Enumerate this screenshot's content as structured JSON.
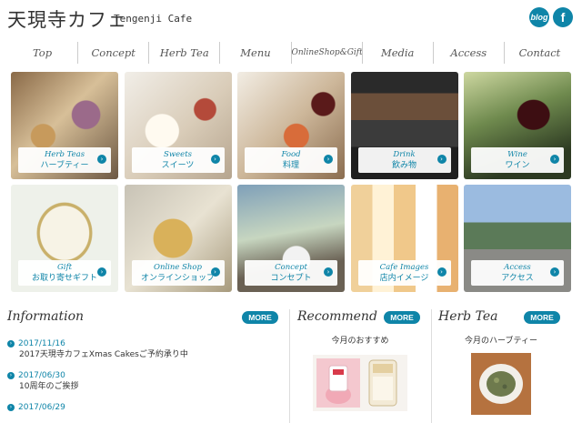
{
  "header": {
    "logo_jp": "天現寺カフェ",
    "logo_en": "Tengenji Cafe",
    "blog_label": "blog",
    "facebook_label": "f"
  },
  "nav": {
    "items": [
      {
        "label": "Top"
      },
      {
        "label": "Concept"
      },
      {
        "label": "Herb Tea"
      },
      {
        "label": "Menu"
      },
      {
        "label": "OnlineShop&Gift"
      },
      {
        "label": "Media"
      },
      {
        "label": "Access"
      },
      {
        "label": "Contact"
      }
    ]
  },
  "tiles": [
    {
      "en": "Herb Teas",
      "jp": "ハーブティー"
    },
    {
      "en": "Sweets",
      "jp": "スイーツ"
    },
    {
      "en": "Food",
      "jp": "料理"
    },
    {
      "en": "Drink",
      "jp": "飲み物"
    },
    {
      "en": "Wine",
      "jp": "ワイン"
    },
    {
      "en": "Gift",
      "jp": "お取り寄せギフト"
    },
    {
      "en": "Online Shop",
      "jp": "オンラインショップ"
    },
    {
      "en": "Concept",
      "jp": "コンセプト"
    },
    {
      "en": "Cafe Images",
      "jp": "店内イメージ"
    },
    {
      "en": "Access",
      "jp": "アクセス"
    }
  ],
  "tile_arrow": "›",
  "information": {
    "title": "Information",
    "more": "MORE",
    "items": [
      {
        "date": "2017/11/16",
        "title": "2017天現寺カフェXmas Cakesご予約承り中"
      },
      {
        "date": "2017/06/30",
        "title": "10周年のご挨拶"
      },
      {
        "date": "2017/06/29",
        "title": ""
      }
    ]
  },
  "recommend": {
    "title": "Recommend",
    "more": "MORE",
    "caption": "今月のおすすめ"
  },
  "herb_tea": {
    "title": "Herb Tea",
    "more": "MORE",
    "caption": "今月のハーブティー"
  }
}
